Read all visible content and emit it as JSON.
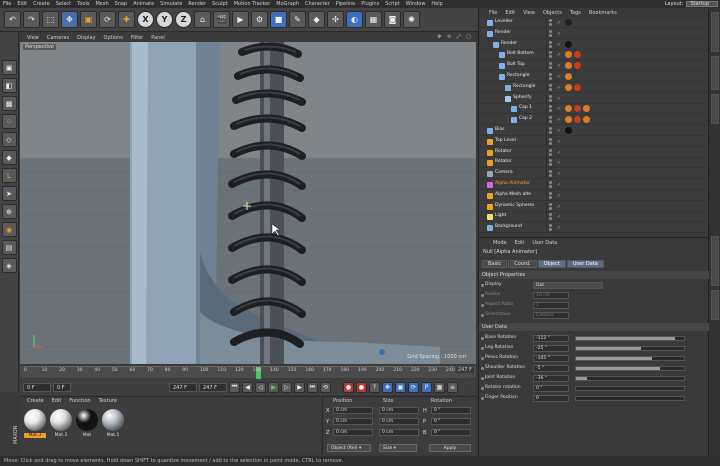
{
  "menubar": {
    "items": [
      "File",
      "Edit",
      "Create",
      "Select",
      "Tools",
      "Mesh",
      "Snap",
      "Animate",
      "Simulate",
      "Render",
      "Sculpt",
      "Motion Tracker",
      "MoGraph",
      "Character",
      "Pipeline",
      "Plugins",
      "Script",
      "Window",
      "Help"
    ],
    "layout_label": "Layout:",
    "layout_value": "Startup"
  },
  "toolbar": {
    "undo_icon": "↶",
    "axis_x": "X",
    "axis_y": "Y",
    "axis_z": "Z"
  },
  "viewport": {
    "menu": [
      "View",
      "Cameras",
      "Display",
      "Options",
      "Filter",
      "Panel"
    ],
    "icons": "✥ ⟲ ⤢ ▢",
    "label": "Perspective",
    "grid_spacing": "Grid Spacing : 1000 cm"
  },
  "timeline": {
    "ticks": [
      "0",
      "10",
      "20",
      "30",
      "40",
      "50",
      "60",
      "70",
      "80",
      "90",
      "100",
      "110",
      "120",
      "130",
      "140",
      "150",
      "160",
      "170",
      "180",
      "190",
      "200",
      "210",
      "220",
      "230",
      "240"
    ],
    "playhead_fraction": 0.55,
    "end_frame": "247 F"
  },
  "transport": {
    "start_field": "0 F",
    "current_field": "0 F",
    "end_field": "247 F",
    "end_field2": "247 F"
  },
  "materials": {
    "menu": [
      "Create",
      "Edit",
      "Function",
      "Texture"
    ],
    "items": [
      {
        "label": "Mat.3",
        "selected": true,
        "color": "#e8e8e8"
      },
      {
        "label": "Mat.2",
        "selected": false,
        "color": "#e0e0e0"
      },
      {
        "label": "Mat",
        "selected": false,
        "color": "#111111"
      },
      {
        "label": "Mat.1",
        "selected": false,
        "color": "#b8bfc8"
      }
    ]
  },
  "coordinates": {
    "headers": [
      "Position",
      "Size",
      "Rotation"
    ],
    "rows": [
      {
        "axis": "X",
        "pos": "0 cm",
        "size": "0 cm",
        "rot_axis": "H",
        "rot": "0 °"
      },
      {
        "axis": "Y",
        "pos": "0 cm",
        "size": "0 cm",
        "rot_axis": "P",
        "rot": "0 °"
      },
      {
        "axis": "Z",
        "pos": "0 cm",
        "size": "0 cm",
        "rot_axis": "B",
        "rot": "0 °"
      }
    ],
    "mode_button": "Object (Rel) ▾",
    "size_button": "Size ▾",
    "apply_button": "Apply"
  },
  "objects": {
    "menu": [
      "File",
      "Edit",
      "View",
      "Objects",
      "Tags",
      "Bookmarks"
    ],
    "rows": [
      {
        "name": "Leveller",
        "indent": 0,
        "icon_color": "#7fb0e8",
        "tags": [
          "#222"
        ]
      },
      {
        "name": "Render",
        "indent": 0,
        "icon_color": "#7fb0e8",
        "tags": []
      },
      {
        "name": "Render",
        "indent": 1,
        "icon_color": "#7fb0e8",
        "tags": [
          "#111"
        ]
      },
      {
        "name": "Bolt Bottom",
        "indent": 2,
        "icon_color": "#7fb0e8",
        "tags": [
          "#e07b2a",
          "#c7391a"
        ]
      },
      {
        "name": "Bolt Top",
        "indent": 2,
        "icon_color": "#7fb0e8",
        "tags": [
          "#e07b2a",
          "#c7391a"
        ]
      },
      {
        "name": "Rectangle",
        "indent": 2,
        "icon_color": "#7fb0e8",
        "tags": [
          "#e07b2a"
        ]
      },
      {
        "name": "Rectangle",
        "indent": 3,
        "icon_color": "#7fb0e8",
        "tags": [
          "#e07b2a",
          "#c7391a"
        ]
      },
      {
        "name": "Spherify",
        "indent": 3,
        "icon_color": "#a6c6f0",
        "tags": []
      },
      {
        "name": "Cap 1",
        "indent": 4,
        "icon_color": "#7fb0e8",
        "tags": [
          "#e07b2a",
          "#c7391a",
          "#e07b2a"
        ]
      },
      {
        "name": "Cap 2",
        "indent": 4,
        "icon_color": "#7fb0e8",
        "tags": [
          "#e07b2a",
          "#c7391a",
          "#e07b2a"
        ]
      },
      {
        "name": "Bias",
        "indent": 0,
        "icon_color": "#7fb0e8",
        "tags": [
          "#111"
        ]
      },
      {
        "name": "Top Level",
        "indent": 0,
        "icon_color": "#f0a020",
        "tags": []
      },
      {
        "name": "Rotator",
        "indent": 0,
        "icon_color": "#f0a020",
        "tags": []
      },
      {
        "name": "Rotator",
        "indent": 0,
        "icon_color": "#f0a020",
        "tags": []
      },
      {
        "name": "Camera",
        "indent": 0,
        "icon_color": "#9aa6b5",
        "tags": []
      },
      {
        "name": "Alpha Animator",
        "indent": 0,
        "icon_color": "#d66be0",
        "tags": [],
        "selected": true
      },
      {
        "name": "Alpha Mesh alte",
        "indent": 0,
        "icon_color": "#f0a020",
        "tags": []
      },
      {
        "name": "Dynamic Spheres",
        "indent": 0,
        "icon_color": "#f0a020",
        "tags": []
      },
      {
        "name": "Light",
        "indent": 0,
        "icon_color": "#f0e070",
        "tags": []
      },
      {
        "name": "Background",
        "indent": 0,
        "icon_color": "#7fb0e8",
        "tags": []
      }
    ]
  },
  "attributes": {
    "menu": [
      "Mode",
      "Edit",
      "User Data"
    ],
    "title": "Null [Alpha Animator]",
    "tabs": [
      {
        "label": "Basic",
        "on": false
      },
      {
        "label": "Coord.",
        "on": false
      },
      {
        "label": "Object",
        "on": true
      },
      {
        "label": "User Data",
        "on": true
      }
    ],
    "object_section": "Object Properties",
    "object_rows": [
      {
        "label": "Display",
        "value": "Dot",
        "dim": false
      },
      {
        "label": "Radius",
        "value": "10 cm",
        "dim": true
      },
      {
        "label": "Aspect Ratio",
        "value": "1",
        "dim": true
      },
      {
        "label": "Orientation",
        "value": "Camera",
        "dim": true
      }
    ],
    "user_section": "User Data",
    "user_rows": [
      {
        "label": "Base Rotation",
        "value": "-112 °",
        "fill": 0.92
      },
      {
        "label": "Leg Rotation",
        "value": "-25 °",
        "fill": 0.6
      },
      {
        "label": "Pelvis Rotation",
        "value": "-105 °",
        "fill": 0.7
      },
      {
        "label": "Shoulder Rotation",
        "value": "-5 °",
        "fill": 0.78
      },
      {
        "label": "Joint Rotation",
        "value": "-36 °",
        "fill": 0.1
      },
      {
        "label": "Rotator rotation",
        "value": "0 °",
        "fill": 0.0
      },
      {
        "label": "Finger Position",
        "value": "0",
        "fill": 0.0
      }
    ]
  },
  "status": {
    "text": "Move: Click and drag to move elements. Hold down SHIFT to quantize movement / add to the selection in point mode, CTRL to remove."
  },
  "brand": {
    "maxon": "MAXON"
  }
}
